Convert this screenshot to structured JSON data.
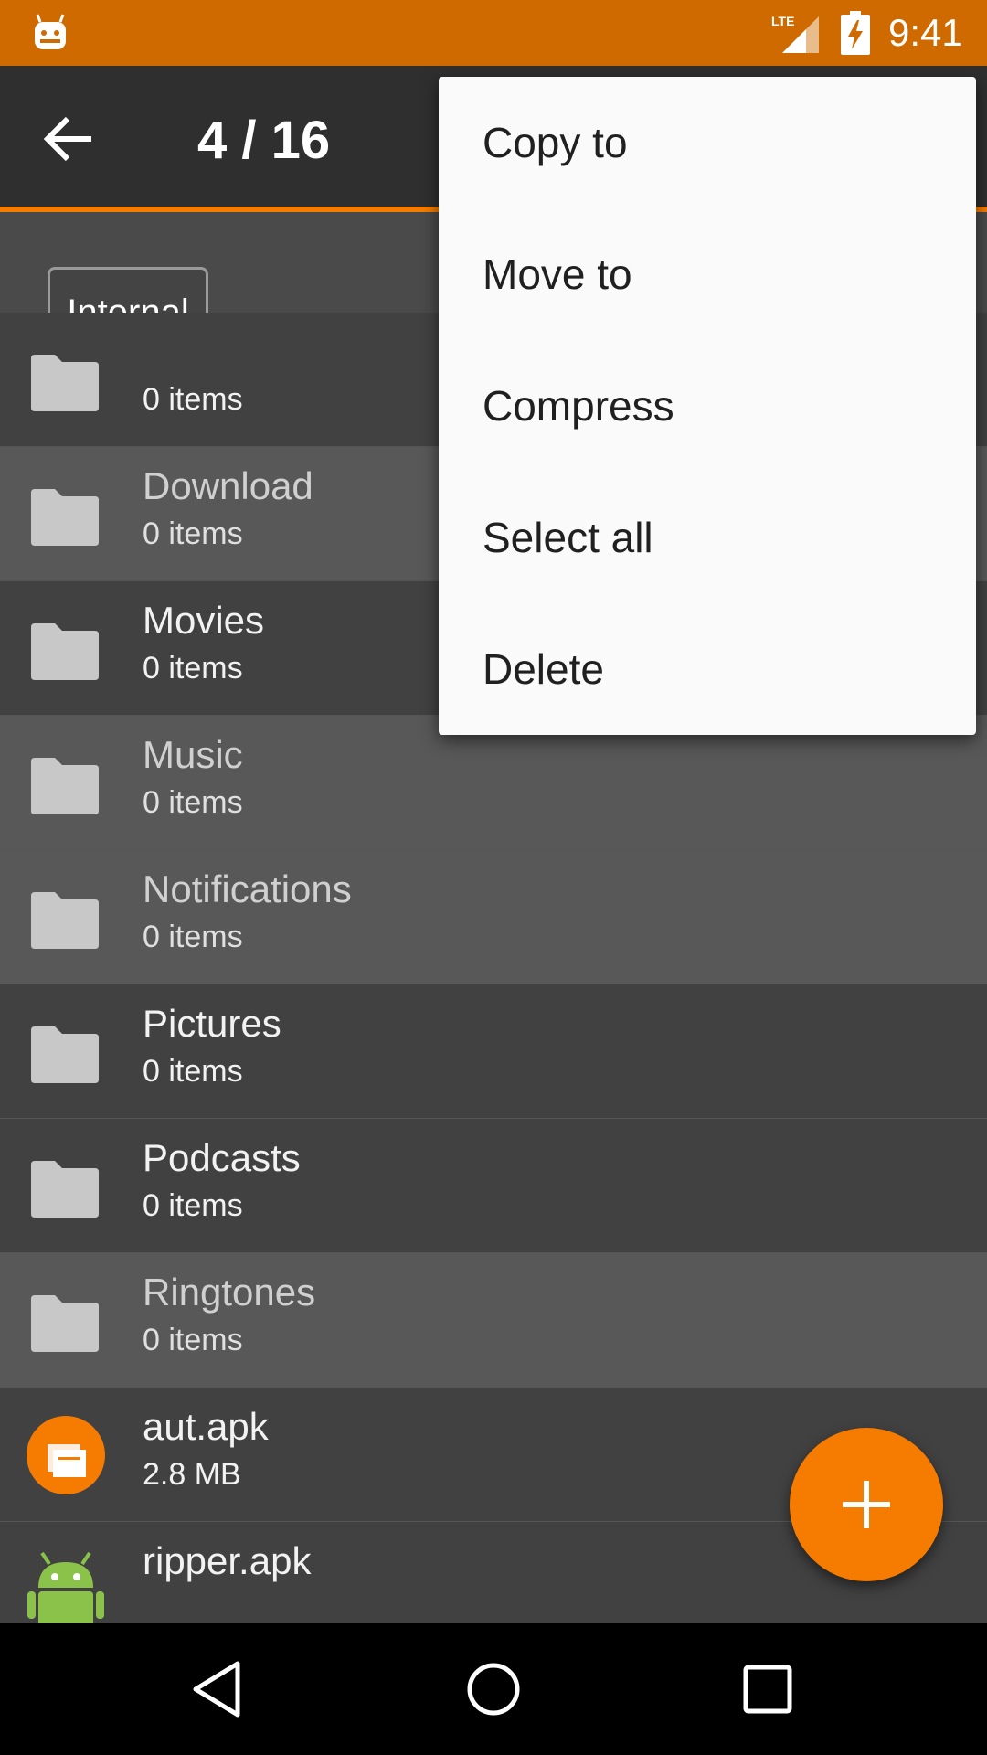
{
  "status_bar": {
    "time": "9:41",
    "network_label": "LTE",
    "icons": [
      "android-debug-icon",
      "lte-signal-icon",
      "battery-charging-icon"
    ]
  },
  "app_bar": {
    "title": "4 / 16",
    "back_icon": "arrow-back-icon"
  },
  "storage": {
    "selected": "Internal"
  },
  "files": [
    {
      "name": "",
      "sub": "0 items",
      "type": "folder",
      "selected": false
    },
    {
      "name": "Download",
      "sub": "0 items",
      "type": "folder",
      "selected": true
    },
    {
      "name": "Movies",
      "sub": "0 items",
      "type": "folder",
      "selected": false
    },
    {
      "name": "Music",
      "sub": "0 items",
      "type": "folder",
      "selected": true
    },
    {
      "name": "Notifications",
      "sub": "0 items",
      "type": "folder",
      "selected": true
    },
    {
      "name": "Pictures",
      "sub": "0 items",
      "type": "folder",
      "selected": false
    },
    {
      "name": "Podcasts",
      "sub": "0 items",
      "type": "folder",
      "selected": false
    },
    {
      "name": "Ringtones",
      "sub": "0 items",
      "type": "folder",
      "selected": true
    },
    {
      "name": "aut.apk",
      "sub": "2.8 MB",
      "type": "apk-app",
      "selected": false
    },
    {
      "name": "ripper.apk",
      "sub": "",
      "type": "apk-android",
      "selected": false
    }
  ],
  "menu": {
    "items": [
      "Copy to",
      "Move to",
      "Compress",
      "Select all",
      "Delete"
    ]
  },
  "fab": {
    "icon": "plus-icon"
  },
  "nav_bar": {
    "icons": [
      "back-triangle-icon",
      "home-circle-icon",
      "recents-square-icon"
    ]
  },
  "colors": {
    "status_bar": "#cf6a00",
    "accent": "#f57c00",
    "app_bar": "#2f2f2f",
    "row_dark": "#414141",
    "row_selected": "#585858",
    "menu_bg": "#fafafa"
  }
}
